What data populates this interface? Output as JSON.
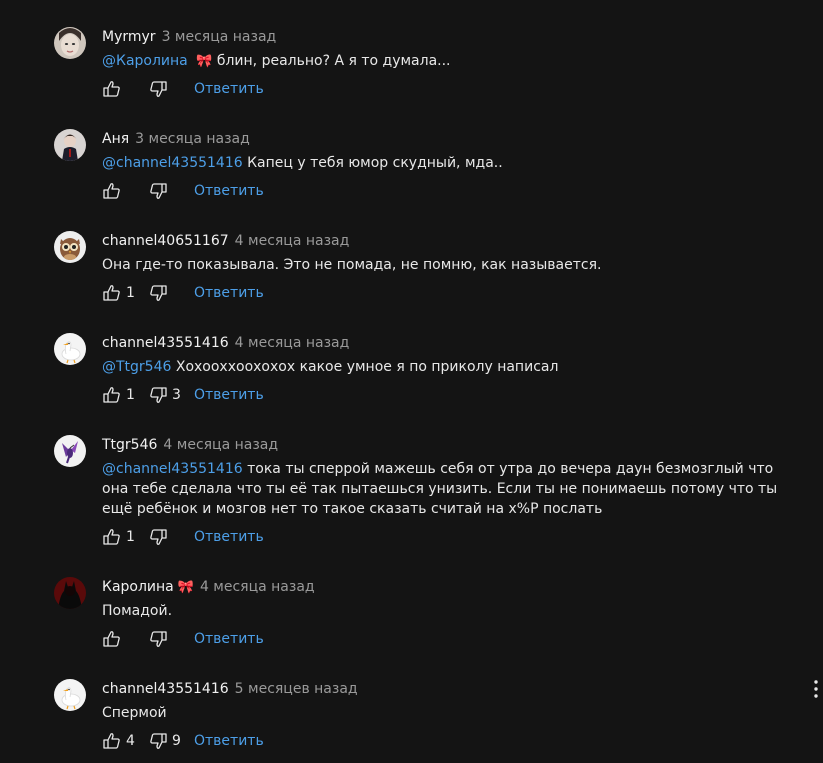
{
  "reply_label": "Ответить",
  "colors": {
    "background": "#141414",
    "mention": "#4d9fe8",
    "reply": "#4d9fe8",
    "time": "#9a9a9a"
  },
  "comments": [
    {
      "author": "Myrmyr",
      "author_emoji": "",
      "time": "3 месяца назад",
      "mention": "",
      "text": "",
      "likes": "",
      "dislikes": "",
      "avatar_icon": "portrait-avatar-icon"
    },
    {
      "author": "Аня",
      "author_emoji": "",
      "time": "3 месяца назад",
      "mention": "@channel43551416",
      "text": "Капец у тебя юмор скудный, мда..",
      "likes": "",
      "dislikes": "",
      "avatar_icon": "person-avatar-icon"
    },
    {
      "author": "channel40651167",
      "author_emoji": "",
      "time": "4 месяца назад",
      "mention": "",
      "text": "Она где-то показывала. Это не помада, не помню, как называется.",
      "likes": "1",
      "dislikes": "",
      "avatar_icon": "owl-avatar-icon"
    },
    {
      "author": "channel43551416",
      "author_emoji": "",
      "time": "4 месяца назад",
      "mention": "@Ttgr546",
      "text": "Хохоохxоохохох какое умное я по приколу написал",
      "likes": "1",
      "dislikes": "3",
      "avatar_icon": "goose-avatar-icon"
    },
    {
      "author": "Ttgr546",
      "author_emoji": "",
      "time": "4 месяца назад",
      "mention": "@channel43551416",
      "text": "тока ты сперрой мажешь себя от утра до вечера даун безмозглый что она тебе сделала что ты её так пытаешься унизить. Если ты не понимаешь потому что ты ещё ребёнок и мозгов нет то такое сказать считай на х%Р послать",
      "likes": "1",
      "dislikes": "",
      "avatar_icon": "hummingbird-avatar-icon"
    },
    {
      "author": "Каролина",
      "author_emoji": "🎀",
      "time": "4 месяца назад",
      "mention": "",
      "text": "Помадой.",
      "likes": "",
      "dislikes": "",
      "avatar_icon": "dark-figure-avatar-icon"
    },
    {
      "author": "channel43551416",
      "author_emoji": "",
      "time": "5 месяцев назад",
      "mention": "",
      "text": "Спермой",
      "likes": "4",
      "dislikes": "9",
      "avatar_icon": "goose-avatar-icon"
    }
  ],
  "first_comment": {
    "mention": "@Каролина",
    "mention_emoji": "🎀",
    "text": "блин, реально? А я то думала..."
  }
}
